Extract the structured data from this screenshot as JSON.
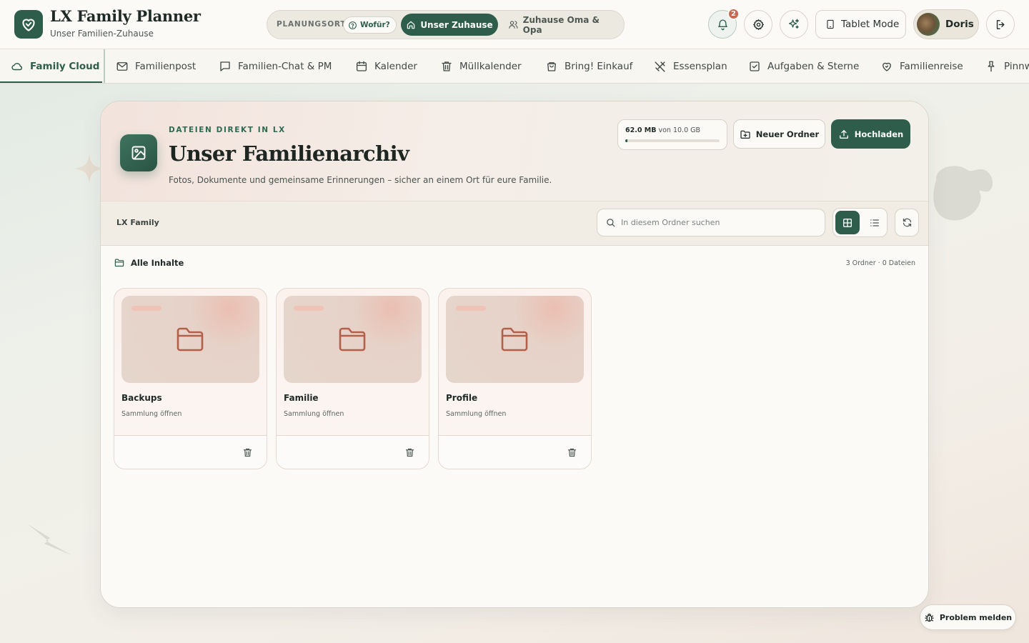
{
  "app": {
    "title": "LX Family Planner",
    "subtitle": "Unser Familien-Zuhause"
  },
  "location": {
    "label": "PLANUNGSORT",
    "help_label": "Wofür?",
    "active": "Unser Zuhause",
    "other": "Zuhause Oma & Opa"
  },
  "header_actions": {
    "notifications_count": "2",
    "tablet_mode_label": "Tablet Mode",
    "user_name": "Doris"
  },
  "nav": {
    "items": [
      {
        "label": "Family Cloud",
        "icon": "cloud-icon",
        "active": true
      },
      {
        "label": "Familienpost",
        "icon": "mail-icon"
      },
      {
        "label": "Familien-Chat & PM",
        "icon": "chat-icon"
      },
      {
        "label": "Kalender",
        "icon": "calendar-icon"
      },
      {
        "label": "Müllkalender",
        "icon": "trash-icon"
      },
      {
        "label": "Bring! Einkauf",
        "icon": "shopping-bag-icon"
      },
      {
        "label": "Essensplan",
        "icon": "cutlery-icon"
      },
      {
        "label": "Aufgaben & Sterne",
        "icon": "checkbox-icon"
      },
      {
        "label": "Familienreise",
        "icon": "heart-icon"
      },
      {
        "label": "Pinnw",
        "icon": "pin-icon"
      }
    ]
  },
  "hero": {
    "eyebrow": "DATEIEN DIREKT IN LX",
    "title": "Unser Familienarchiv",
    "description": "Fotos, Dokumente und gemeinsame Erinnerungen – sicher an einem Ort für eure Familie."
  },
  "storage": {
    "used": "62.0 MB",
    "total_text": "von 10.0 GB",
    "fraction": 0.006
  },
  "actions": {
    "new_folder": "Neuer Ordner",
    "upload": "Hochladen"
  },
  "toolbar": {
    "breadcrumb": "LX Family",
    "search_placeholder": "In diesem Ordner suchen"
  },
  "content": {
    "section_label": "Alle Inhalte",
    "counts": "3 Ordner · 0 Dateien",
    "folders": [
      {
        "name": "Backups",
        "subtitle": "Sammlung öffnen"
      },
      {
        "name": "Familie",
        "subtitle": "Sammlung öffnen"
      },
      {
        "name": "Profile",
        "subtitle": "Sammlung öffnen"
      }
    ]
  },
  "problem_button": "Problem melden",
  "colors": {
    "brand": "#2e5e4b",
    "accent": "#c9674f",
    "background": "#eef0ea"
  }
}
